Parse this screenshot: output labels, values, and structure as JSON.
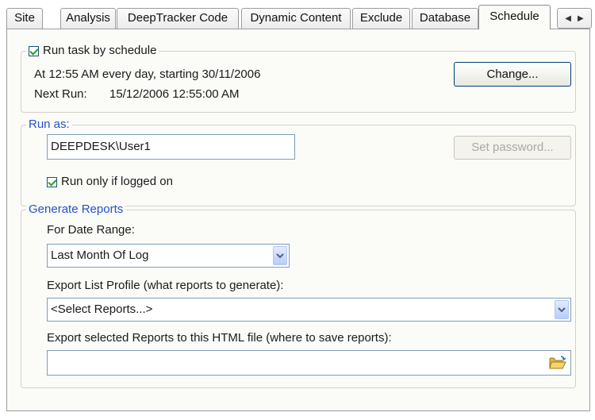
{
  "tabs": [
    {
      "label": "Site",
      "active": false
    },
    {
      "label": "Analysis",
      "active": false
    },
    {
      "label": "DeepTracker Code",
      "active": false
    },
    {
      "label": "Dynamic Content",
      "active": false
    },
    {
      "label": "Exclude",
      "active": false
    },
    {
      "label": "Database",
      "active": false
    },
    {
      "label": "Schedule",
      "active": true
    }
  ],
  "tab_scroll": {
    "left_icon": "arrow-left-icon",
    "right_icon": "arrow-right-icon"
  },
  "schedule": {
    "checkbox_label": "Run task by schedule",
    "checked": true,
    "summary": "At 12:55 AM every day, starting 30/11/2006",
    "next_run_label": "Next Run:",
    "next_run_value": "15/12/2006 12:55:00 AM",
    "change_button": "Change..."
  },
  "run_as": {
    "legend": "Run as:",
    "user_value": "DEEPDESK\\User1",
    "set_password_button": "Set password...",
    "set_password_enabled": false,
    "logged_on_label": "Run only if logged on",
    "logged_on_checked": true
  },
  "reports": {
    "legend": "Generate Reports",
    "date_range_label": "For Date Range:",
    "date_range_value": "Last Month Of Log",
    "profile_label": "Export List Profile (what reports to generate):",
    "profile_value": "<Select Reports...>",
    "html_file_label": "Export selected Reports to this HTML file (where to save reports):",
    "html_file_value": ""
  },
  "colors": {
    "legend_blue": "#2452c8",
    "input_border": "#7f9db9",
    "button_border": "#003c74"
  }
}
